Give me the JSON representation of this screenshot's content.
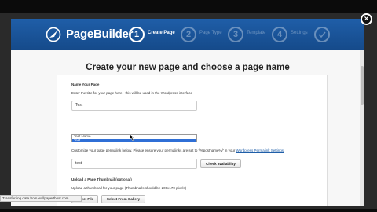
{
  "app": {
    "name": "PageBuilder"
  },
  "steps": [
    {
      "number": "1",
      "label": "Create Page"
    },
    {
      "number": "2",
      "label": "Page Type"
    },
    {
      "number": "3",
      "label": "Template"
    },
    {
      "number": "4",
      "label": "Settings"
    },
    {
      "number": "",
      "label": ""
    }
  ],
  "main": {
    "title": "Create your new page and choose a page name",
    "name_section": {
      "label": "Name Your Page",
      "help": "Enter the title for your page here - this will be used in the Wordpress interface",
      "value": "Test",
      "autocomplete": [
        "Test Name",
        "Test"
      ]
    },
    "permalink": {
      "help_prefix": "Customize your page permalink below. Please ensure your permalinks are set to '/%postname%/' in your",
      "help_link": "Wordpress Permalink Settings",
      "value": "test",
      "button": "Check availability"
    },
    "thumbnail": {
      "label": "Upload a Page Thumbnail (optional)",
      "help": "Upload a thumbnail for your page (Thumbnails should be 200x170 pixels)",
      "select_file": "Select File",
      "select_gallery": "Select From Gallery"
    }
  },
  "status_bar": {
    "text": "Transferring data from wallpaperthost.com..."
  },
  "close_label": "×",
  "colors": {
    "header": "#1a56a0",
    "accent": "#2f6fd6"
  }
}
